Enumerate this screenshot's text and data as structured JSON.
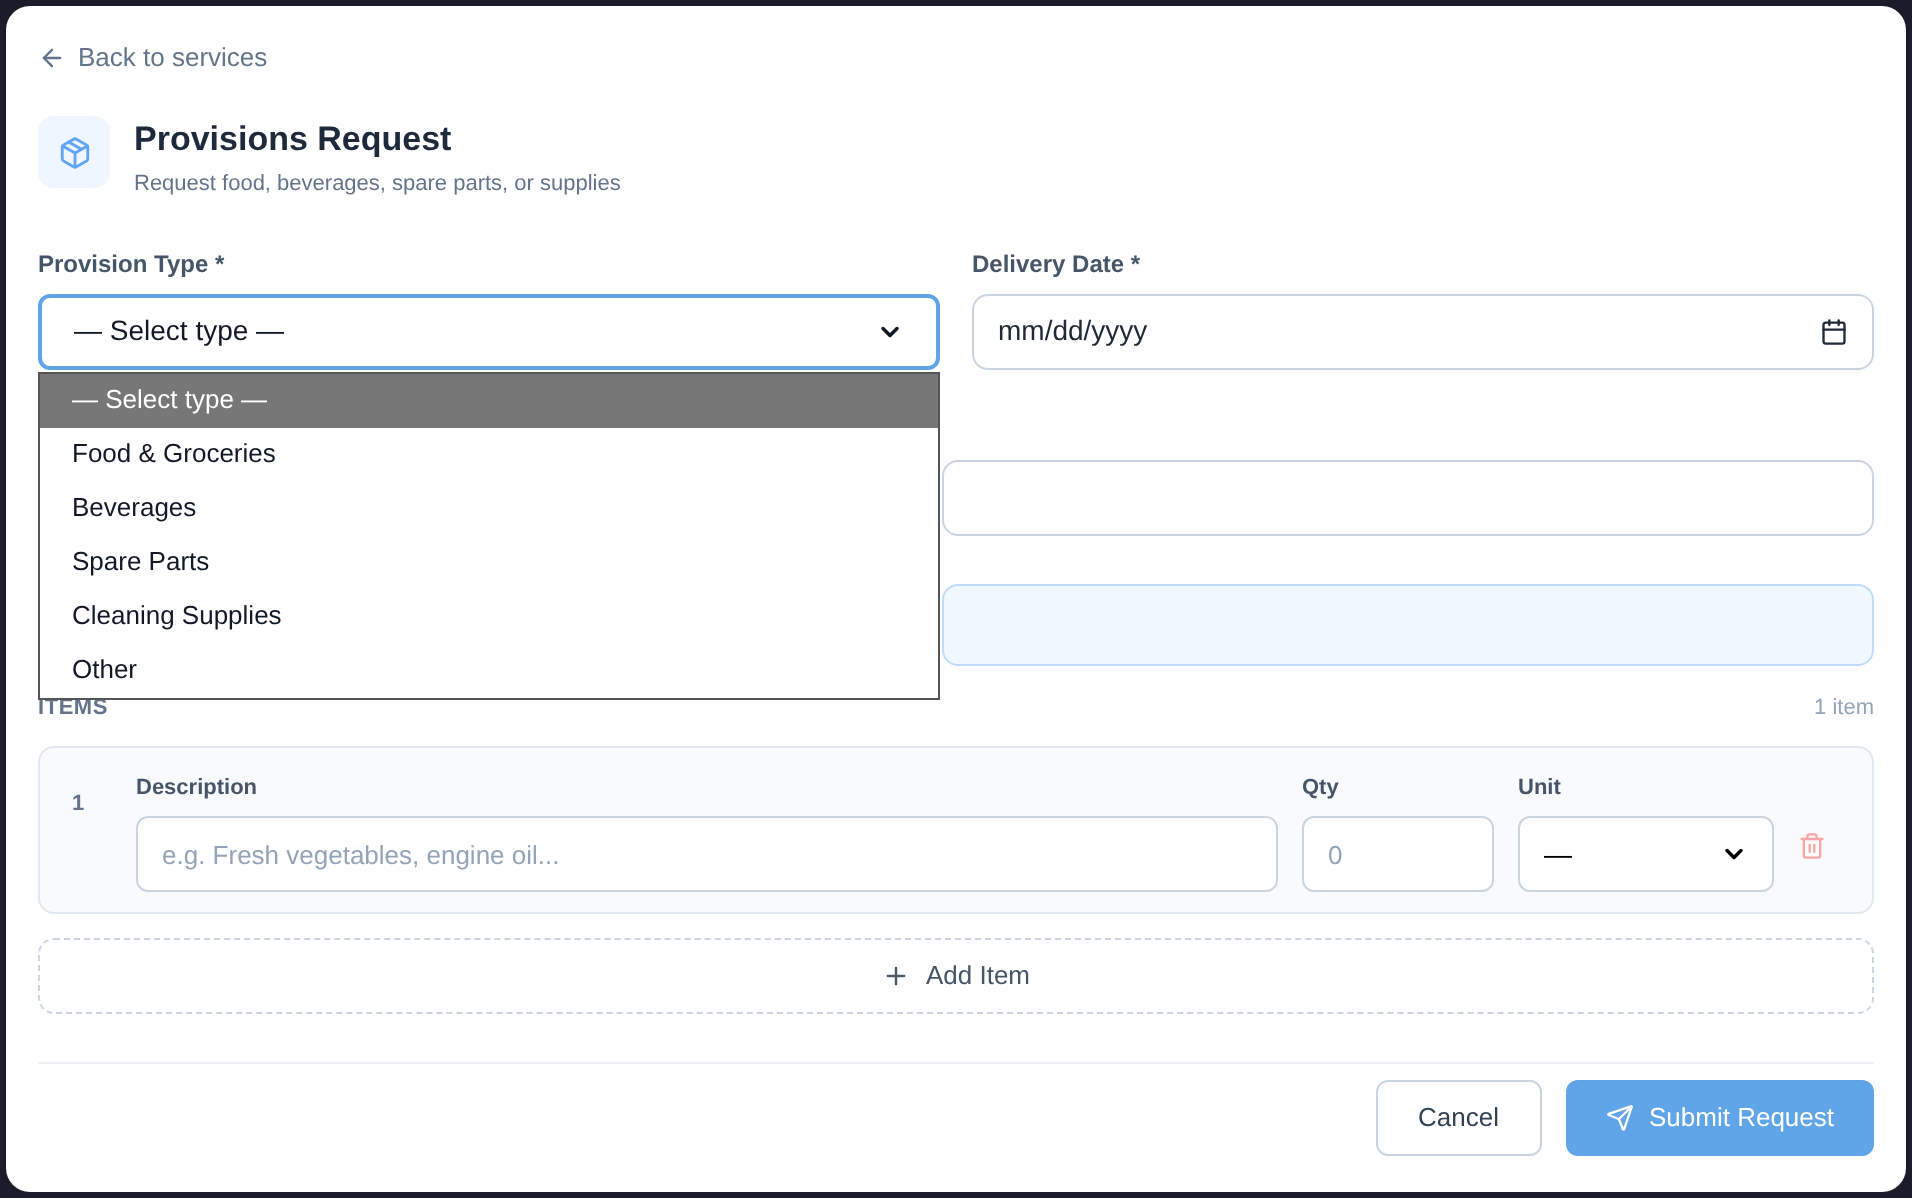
{
  "back_link": "Back to services",
  "header": {
    "title": "Provisions Request",
    "subtitle": "Request food, beverages, spare parts, or supplies"
  },
  "provision_type": {
    "label": "Provision Type *",
    "value": "— Select type —",
    "open": true,
    "options": [
      {
        "label": "— Select type —",
        "selected": true
      },
      {
        "label": "Food & Groceries",
        "selected": false
      },
      {
        "label": "Beverages",
        "selected": false
      },
      {
        "label": "Spare Parts",
        "selected": false
      },
      {
        "label": "Cleaning Supplies",
        "selected": false
      },
      {
        "label": "Other",
        "selected": false
      }
    ]
  },
  "delivery_date": {
    "label": "Delivery Date *",
    "placeholder": "mm/dd/yyyy"
  },
  "items_section": {
    "title": "ITEMS",
    "count": "1 item",
    "columns": {
      "description": "Description",
      "qty": "Qty",
      "unit": "Unit"
    },
    "rows": [
      {
        "number": "1",
        "description_placeholder": "e.g. Fresh vegetables, engine oil...",
        "qty_placeholder": "0",
        "unit": "—"
      }
    ],
    "add_button": "Add Item"
  },
  "buttons": {
    "cancel": "Cancel",
    "submit": "Submit Request"
  }
}
